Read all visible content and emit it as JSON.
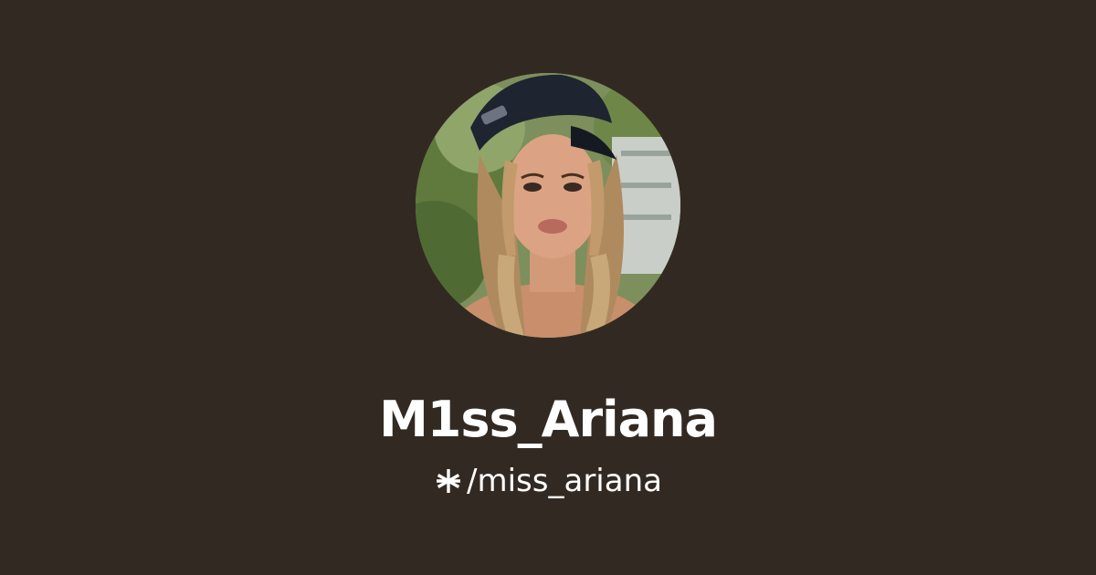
{
  "profile": {
    "display_name": "M1ss_Ariana",
    "handle": "/miss_ariana",
    "avatar_icon": "profile-photo",
    "brand_icon": "linktree-asterisk-icon"
  },
  "theme": {
    "background": "#322a22",
    "text": "#ffffff"
  }
}
